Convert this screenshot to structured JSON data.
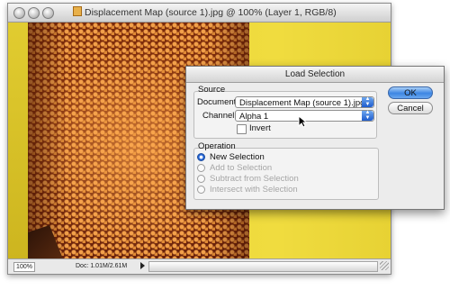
{
  "document_window": {
    "title": "Displacement Map (source 1).jpg @ 100% (Layer 1, RGB/8)",
    "status": {
      "zoom": "100%",
      "doc_size": "Doc: 1.01M/2.61M"
    }
  },
  "dialog": {
    "title": "Load Selection",
    "source": {
      "legend": "Source",
      "document_label": "Document:",
      "document_value": "Displacement Map (source 1).jpg",
      "channel_label": "Channel:",
      "channel_value": "Alpha 1",
      "invert_label": "Invert",
      "invert_checked": false
    },
    "operation": {
      "legend": "Operation",
      "options": [
        {
          "label": "New Selection",
          "selected": true,
          "enabled": true
        },
        {
          "label": "Add to Selection",
          "selected": false,
          "enabled": false
        },
        {
          "label": "Subtract from Selection",
          "selected": false,
          "enabled": false
        },
        {
          "label": "Intersect with Selection",
          "selected": false,
          "enabled": false
        }
      ]
    },
    "buttons": {
      "ok": "OK",
      "cancel": "Cancel"
    }
  },
  "colors": {
    "accent_blue": "#3d86e3",
    "canvas_yellow": "#ead63a",
    "texture_orange": "#e08a34"
  }
}
